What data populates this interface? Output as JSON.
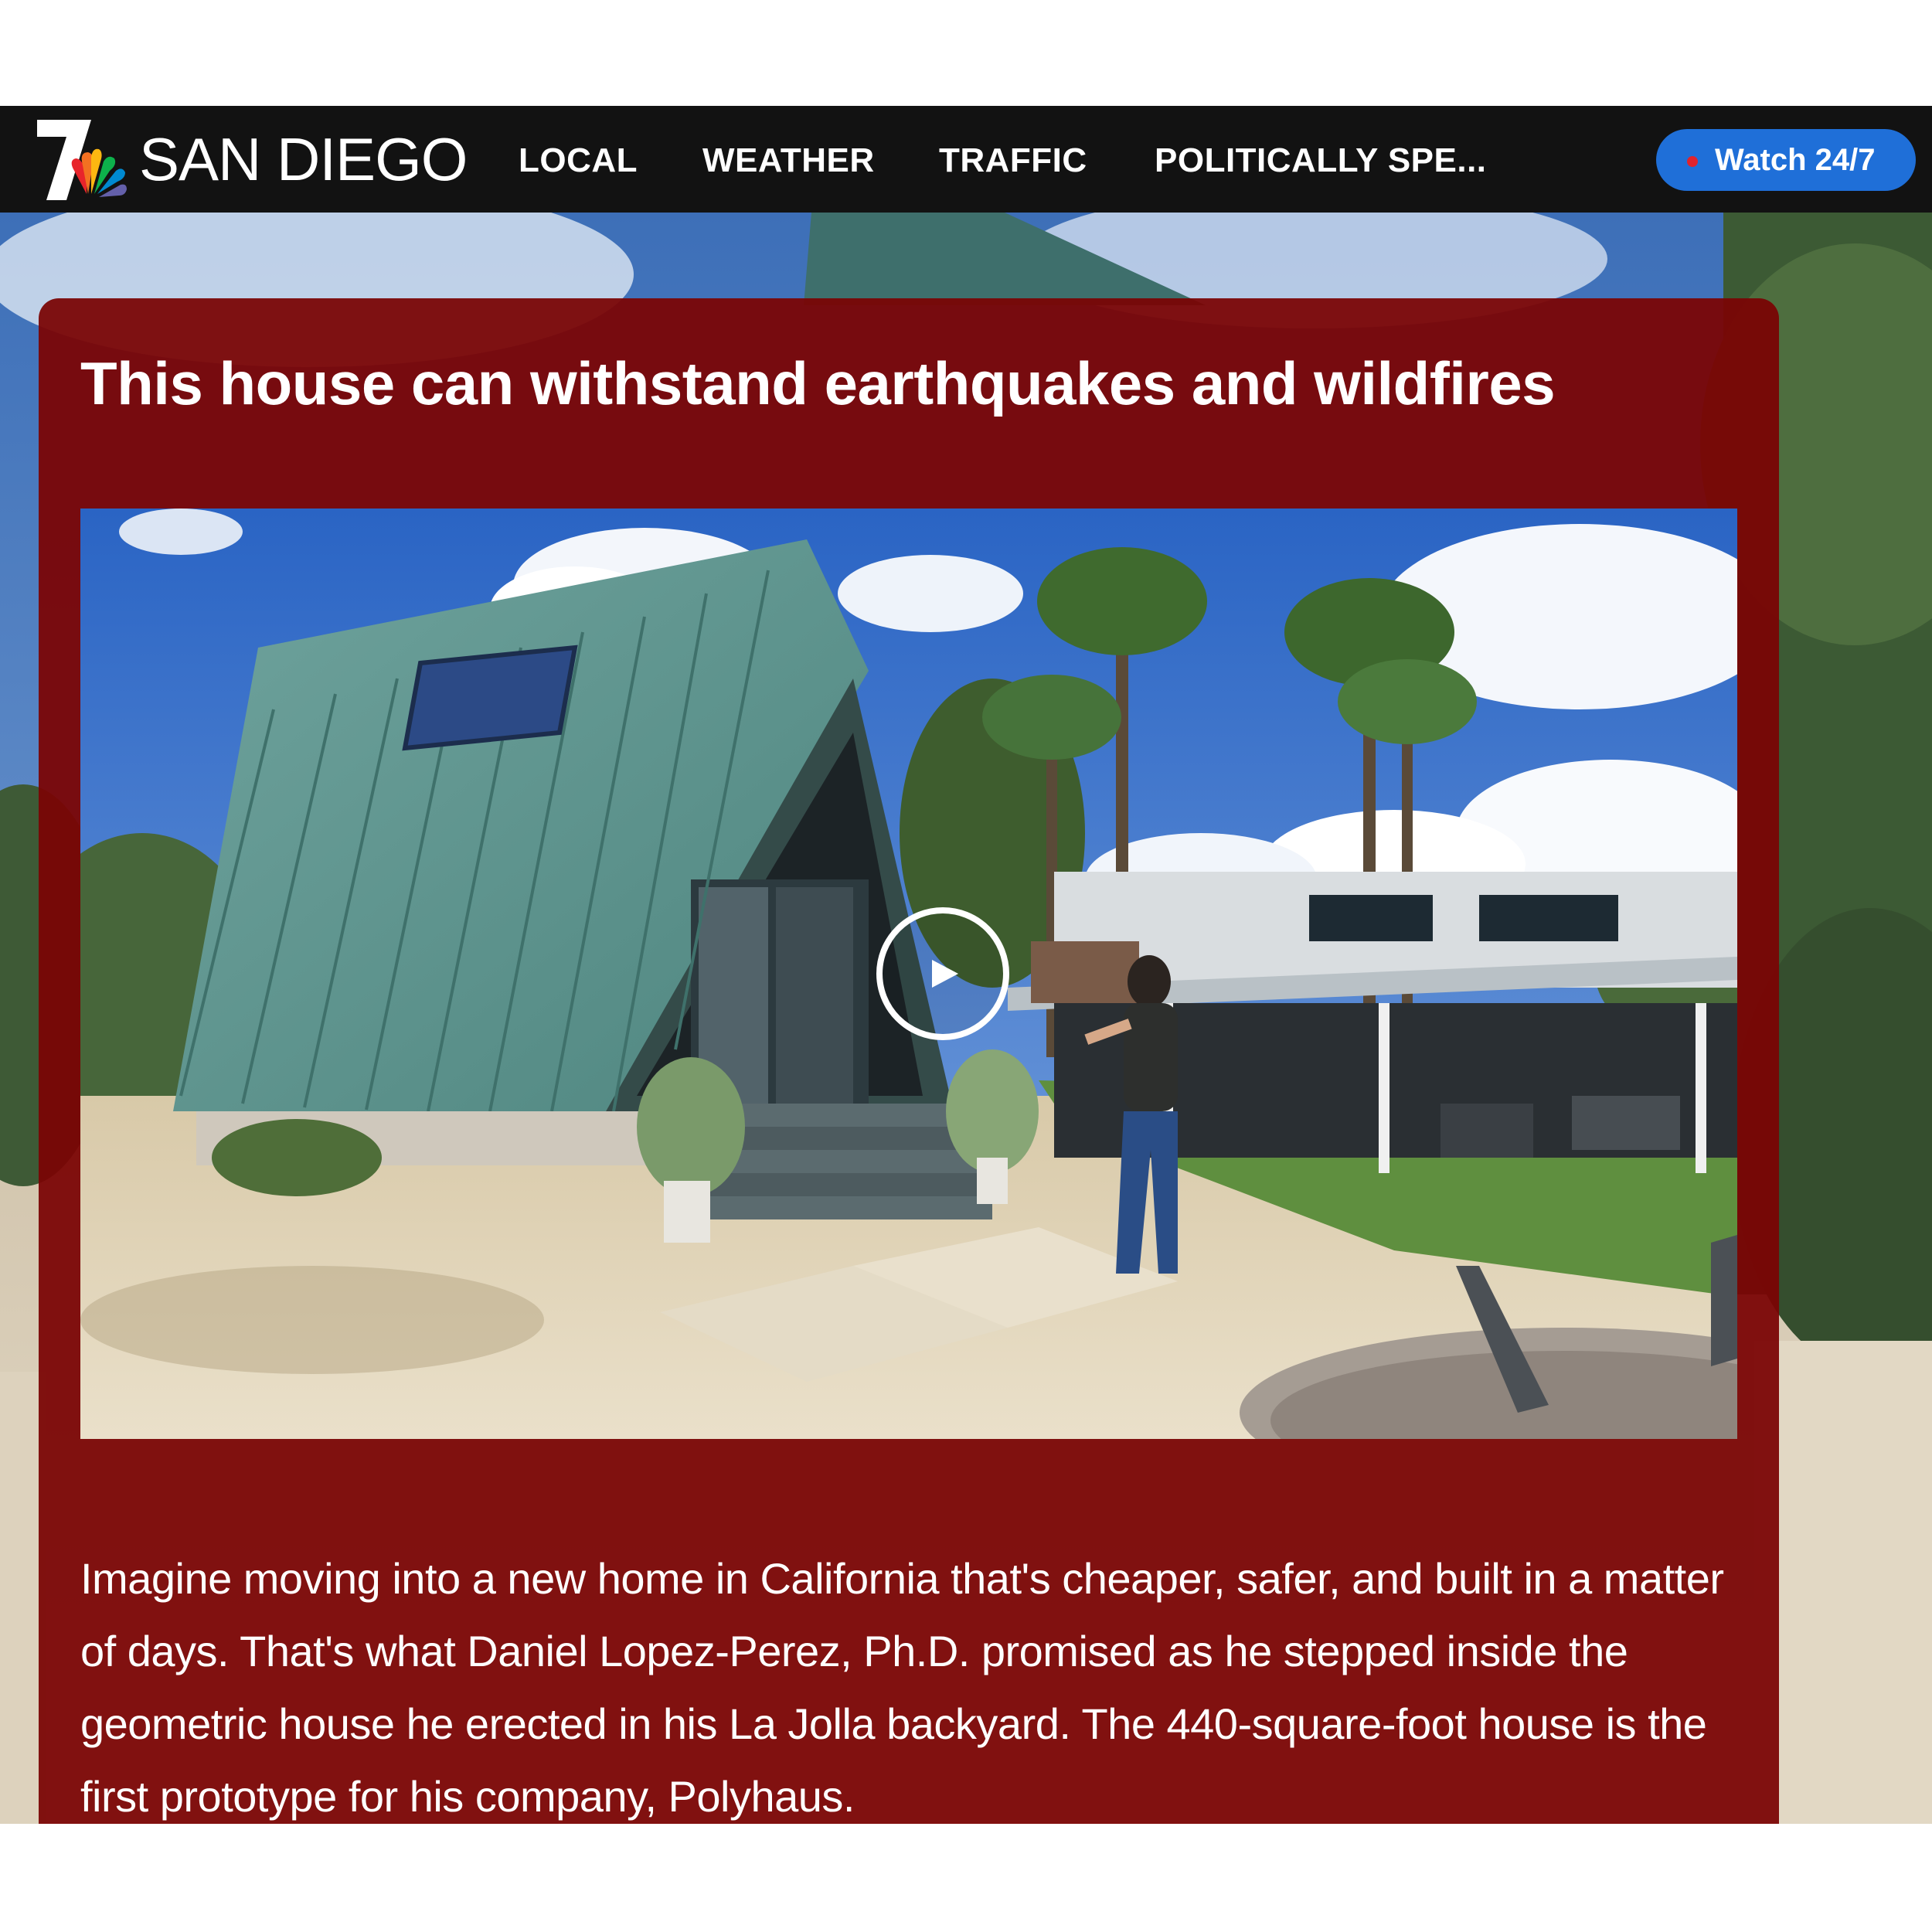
{
  "header": {
    "brand": "SAN DIEGO",
    "nav": [
      {
        "label": "LOCAL"
      },
      {
        "label": "WEATHER"
      },
      {
        "label": "TRAFFIC"
      },
      {
        "label": "POLITICALLY SPE..."
      }
    ],
    "watch_button": "Watch 24/7"
  },
  "article": {
    "headline": "This house can withstand earthquakes and wildfires",
    "summary": "Imagine moving into a new home in California that's cheaper, safer, and built in a matter of days. That's what Daniel Lopez-Perez, Ph.D. promised as he stepped inside the geometric house he erected in his La Jolla backyard. The 440-square-foot house is the first prototype for his company, Polyhaus."
  },
  "icons": {
    "logo": "nbc-peacock-7-logo",
    "play": "play-icon",
    "live": "live-dot-icon"
  },
  "colors": {
    "navbar": "#121212",
    "card": "#7a0404",
    "watch_button": "#1f6fd8",
    "live_dot": "#e0232d"
  }
}
